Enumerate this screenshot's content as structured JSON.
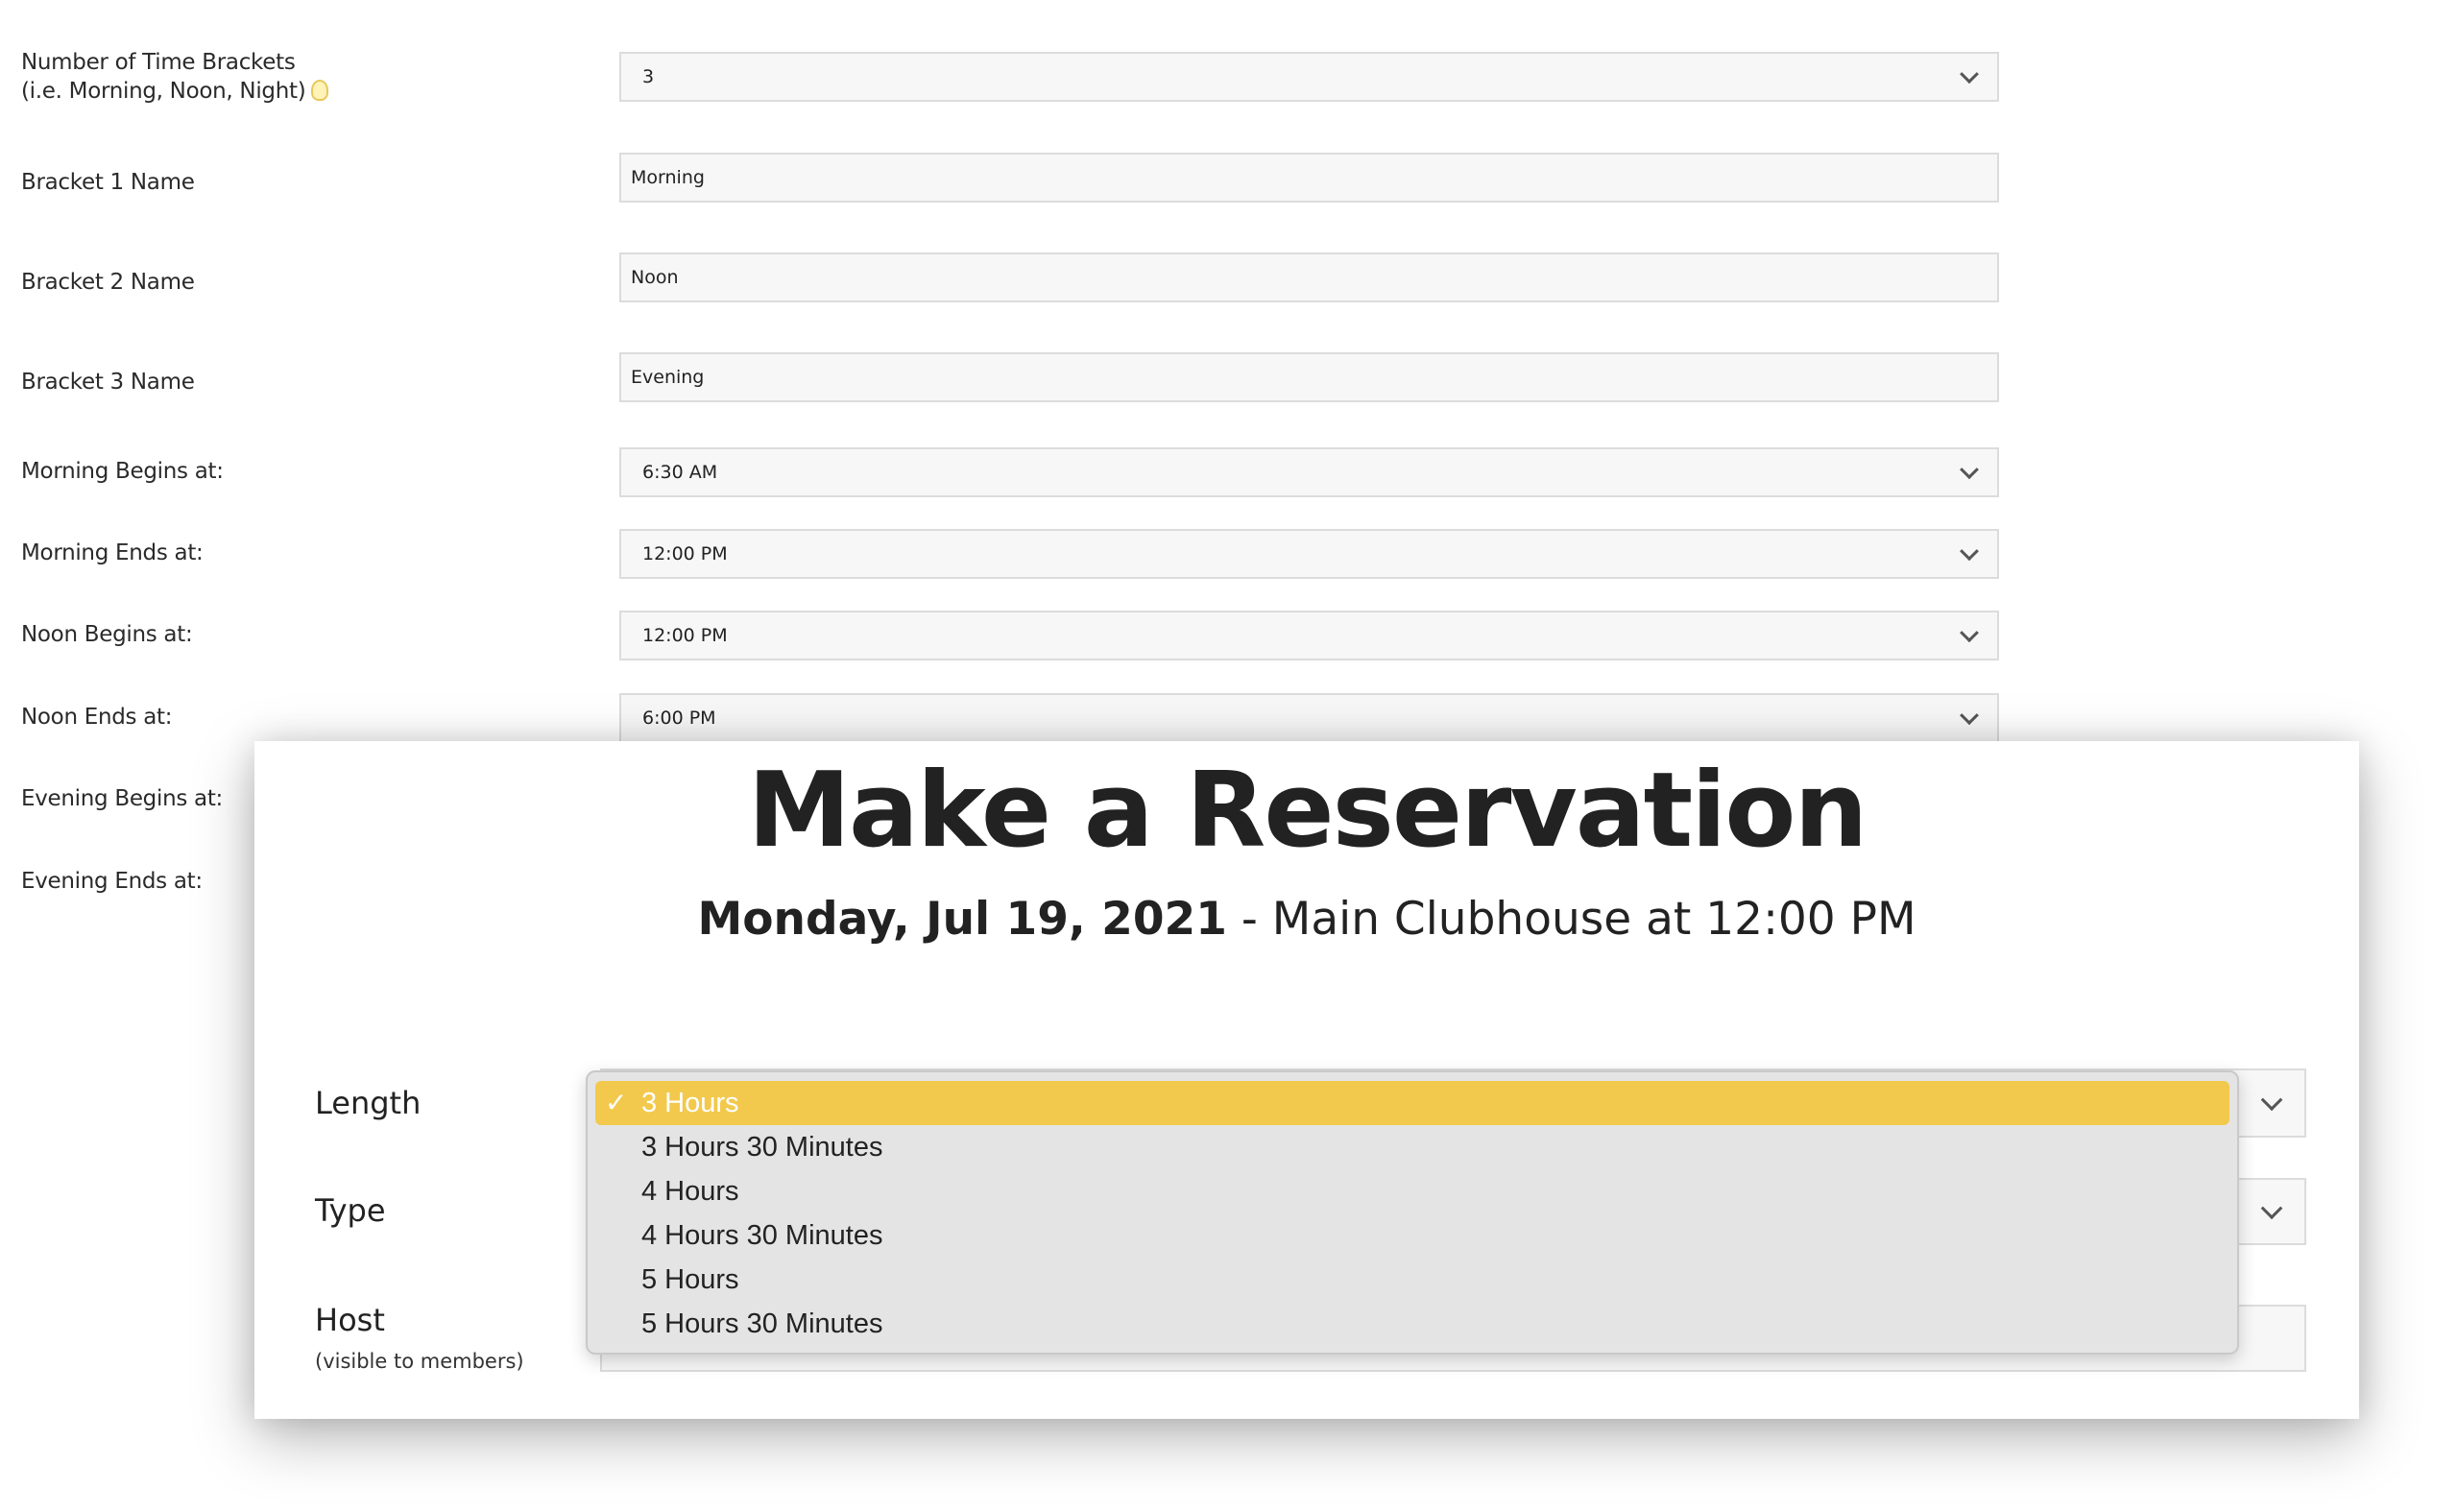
{
  "settings": {
    "brackets_label_line1": "Number of Time Brackets",
    "brackets_label_line2": "(i.e. Morning, Noon, Night)",
    "brackets_value": "3",
    "rows": [
      {
        "label": "Bracket 1 Name",
        "value": "Morning",
        "kind": "input"
      },
      {
        "label": "Bracket 2 Name",
        "value": "Noon",
        "kind": "input"
      },
      {
        "label": "Bracket 3 Name",
        "value": "Evening",
        "kind": "input"
      },
      {
        "label": "Morning Begins at:",
        "value": "6:30 AM",
        "kind": "select"
      },
      {
        "label": "Morning Ends at:",
        "value": "12:00 PM",
        "kind": "select"
      },
      {
        "label": "Noon Begins at:",
        "value": "12:00 PM",
        "kind": "select"
      },
      {
        "label": "Noon Ends at:",
        "value": "6:00 PM",
        "kind": "select"
      },
      {
        "label": "Evening Begins at:"
      },
      {
        "label": "Evening Ends at:"
      }
    ]
  },
  "modal": {
    "title": "Make a Reservation",
    "date": "Monday, Jul 19, 2021",
    "separator": " - ",
    "location": "Main Clubhouse at 12:00 PM",
    "length_label": "Length",
    "type_label": "Type",
    "host_label": "Host",
    "host_sublabel": "(visible to members)"
  },
  "length_dropdown": {
    "check": "✓",
    "selected_index": 0,
    "options": [
      "3 Hours",
      "3 Hours 30 Minutes",
      "4 Hours",
      "4 Hours 30 Minutes",
      "5 Hours",
      "5 Hours 30 Minutes"
    ]
  },
  "colors": {
    "highlight": "#f2c94c",
    "field_bg": "#f7f7f7",
    "dropdown_bg": "#e4e4e4"
  }
}
